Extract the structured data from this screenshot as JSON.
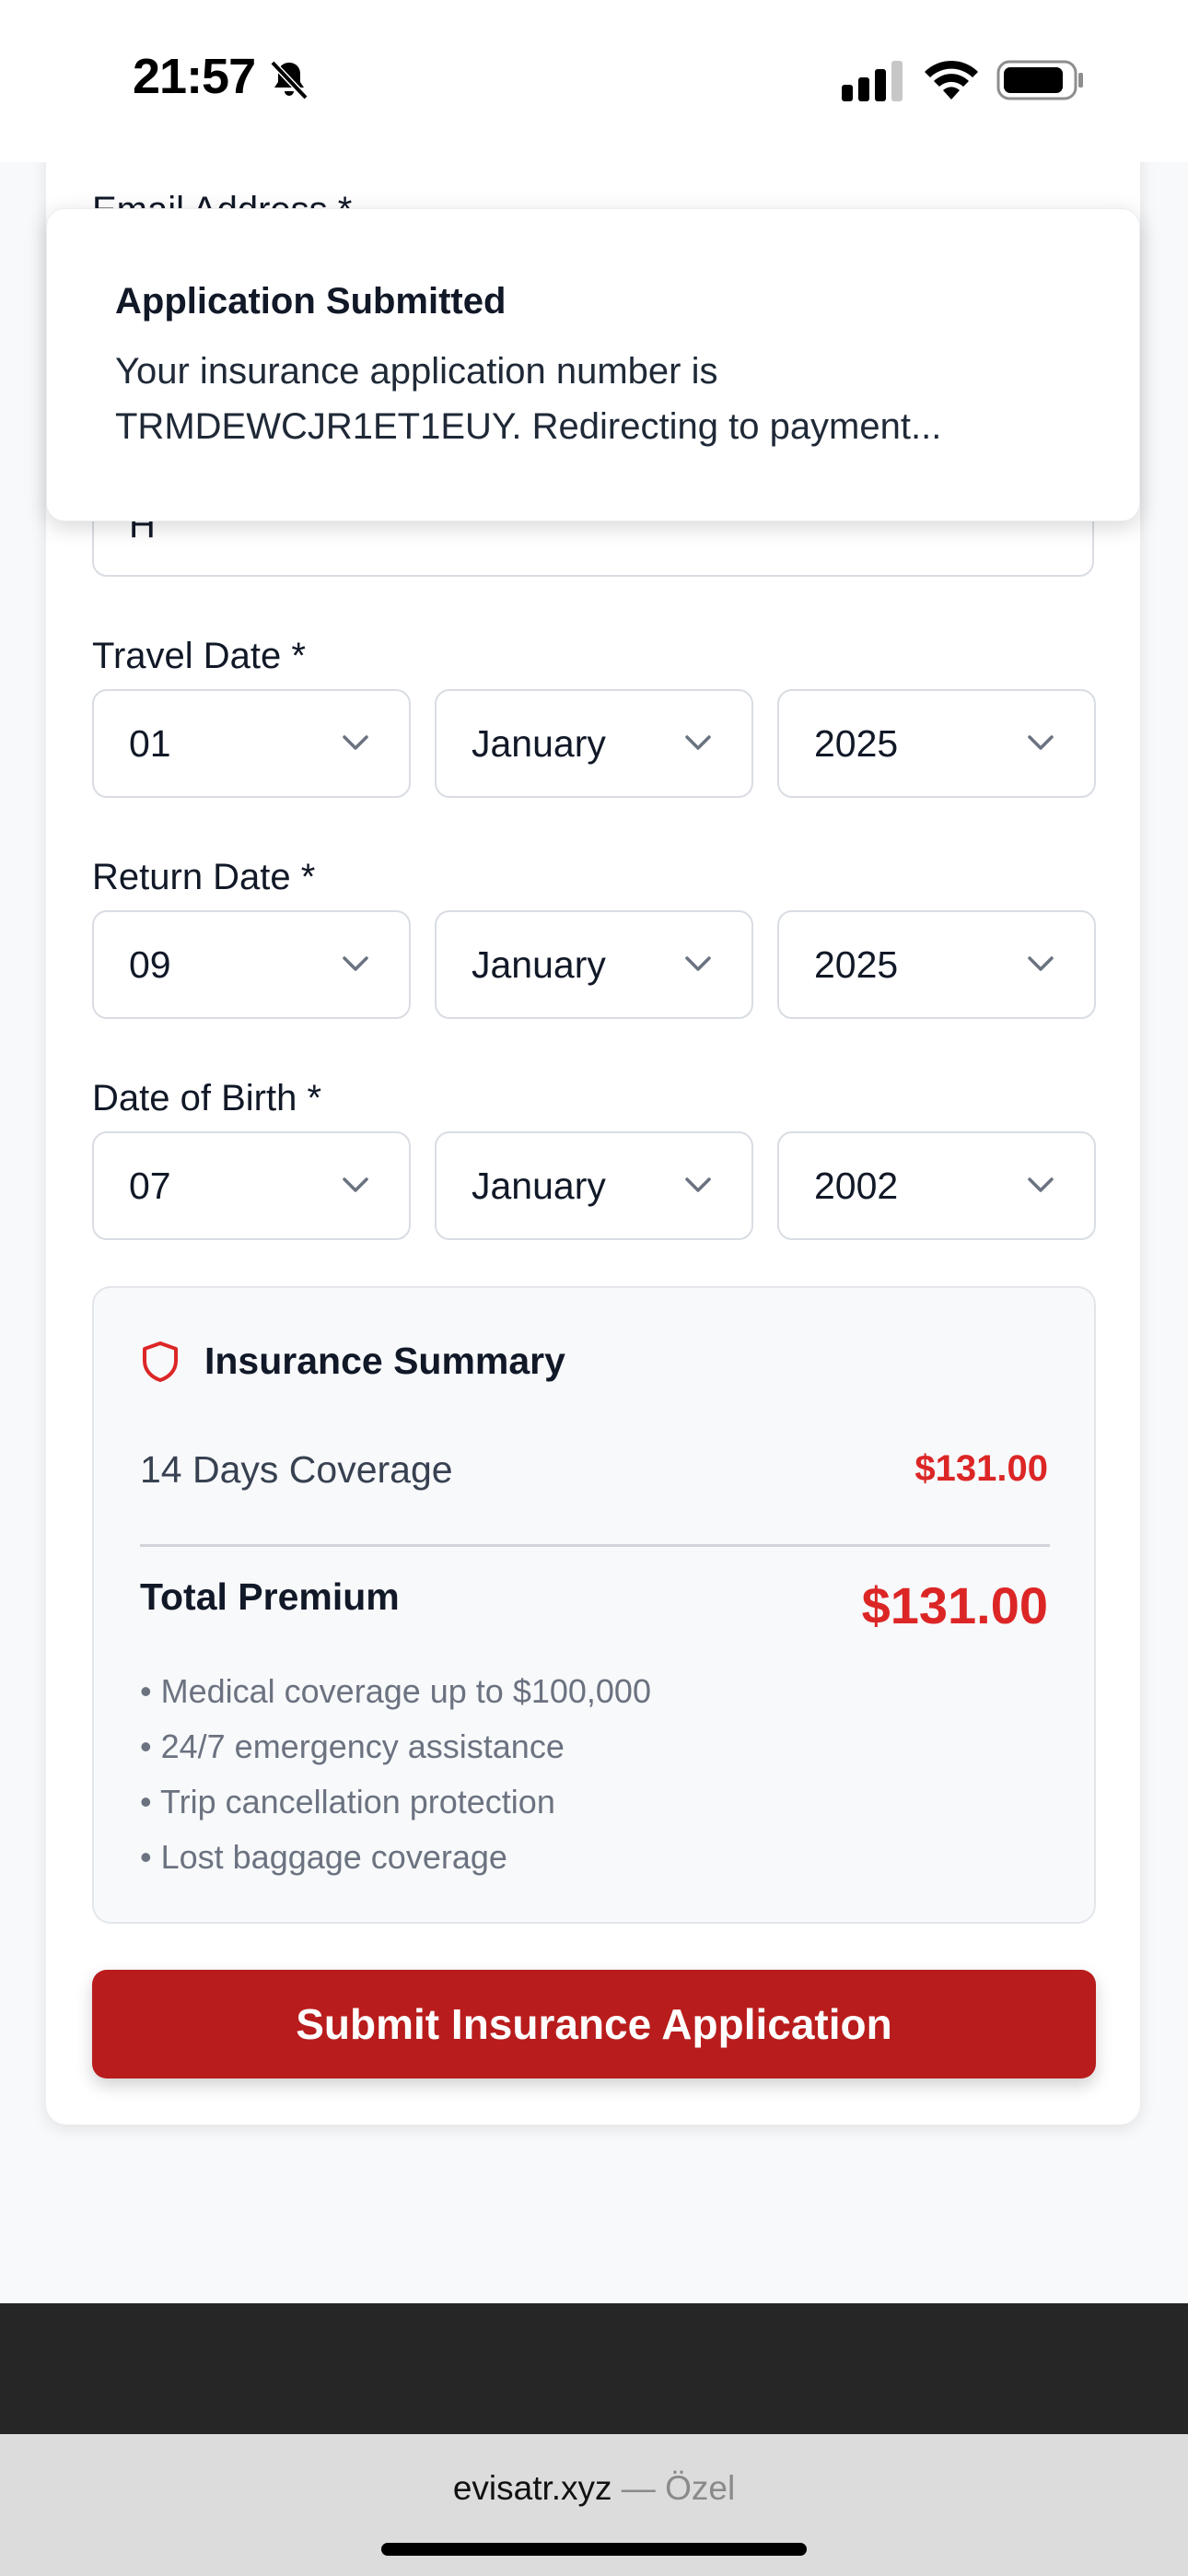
{
  "status_bar": {
    "time": "21:57"
  },
  "form": {
    "hidden_label": "Email Address *",
    "partial_field_value": "H",
    "travel_date": {
      "label": "Travel Date *",
      "day": "01",
      "month": "January",
      "year": "2025"
    },
    "return_date": {
      "label": "Return Date *",
      "day": "09",
      "month": "January",
      "year": "2025"
    },
    "date_of_birth": {
      "label": "Date of Birth *",
      "day": "07",
      "month": "January",
      "year": "2002"
    }
  },
  "toast": {
    "title": "Application Submitted",
    "message": "Your insurance application number is TRMDEWCJR1ET1EUY. Redirecting to payment..."
  },
  "summary": {
    "title": "Insurance Summary",
    "coverage_label": "14 Days Coverage",
    "coverage_price": "$131.00",
    "total_label": "Total Premium",
    "total_price": "$131.00",
    "features": [
      "• Medical coverage up to $100,000",
      "• 24/7 emergency assistance",
      "• Trip cancellation protection",
      "• Lost baggage coverage"
    ]
  },
  "submit_label": "Submit Insurance Application",
  "browser": {
    "domain": "evisatr.xyz",
    "separator": " — ",
    "private_label": "Özel"
  },
  "colors": {
    "accent": "#b91c1c",
    "price": "#dc2626"
  }
}
